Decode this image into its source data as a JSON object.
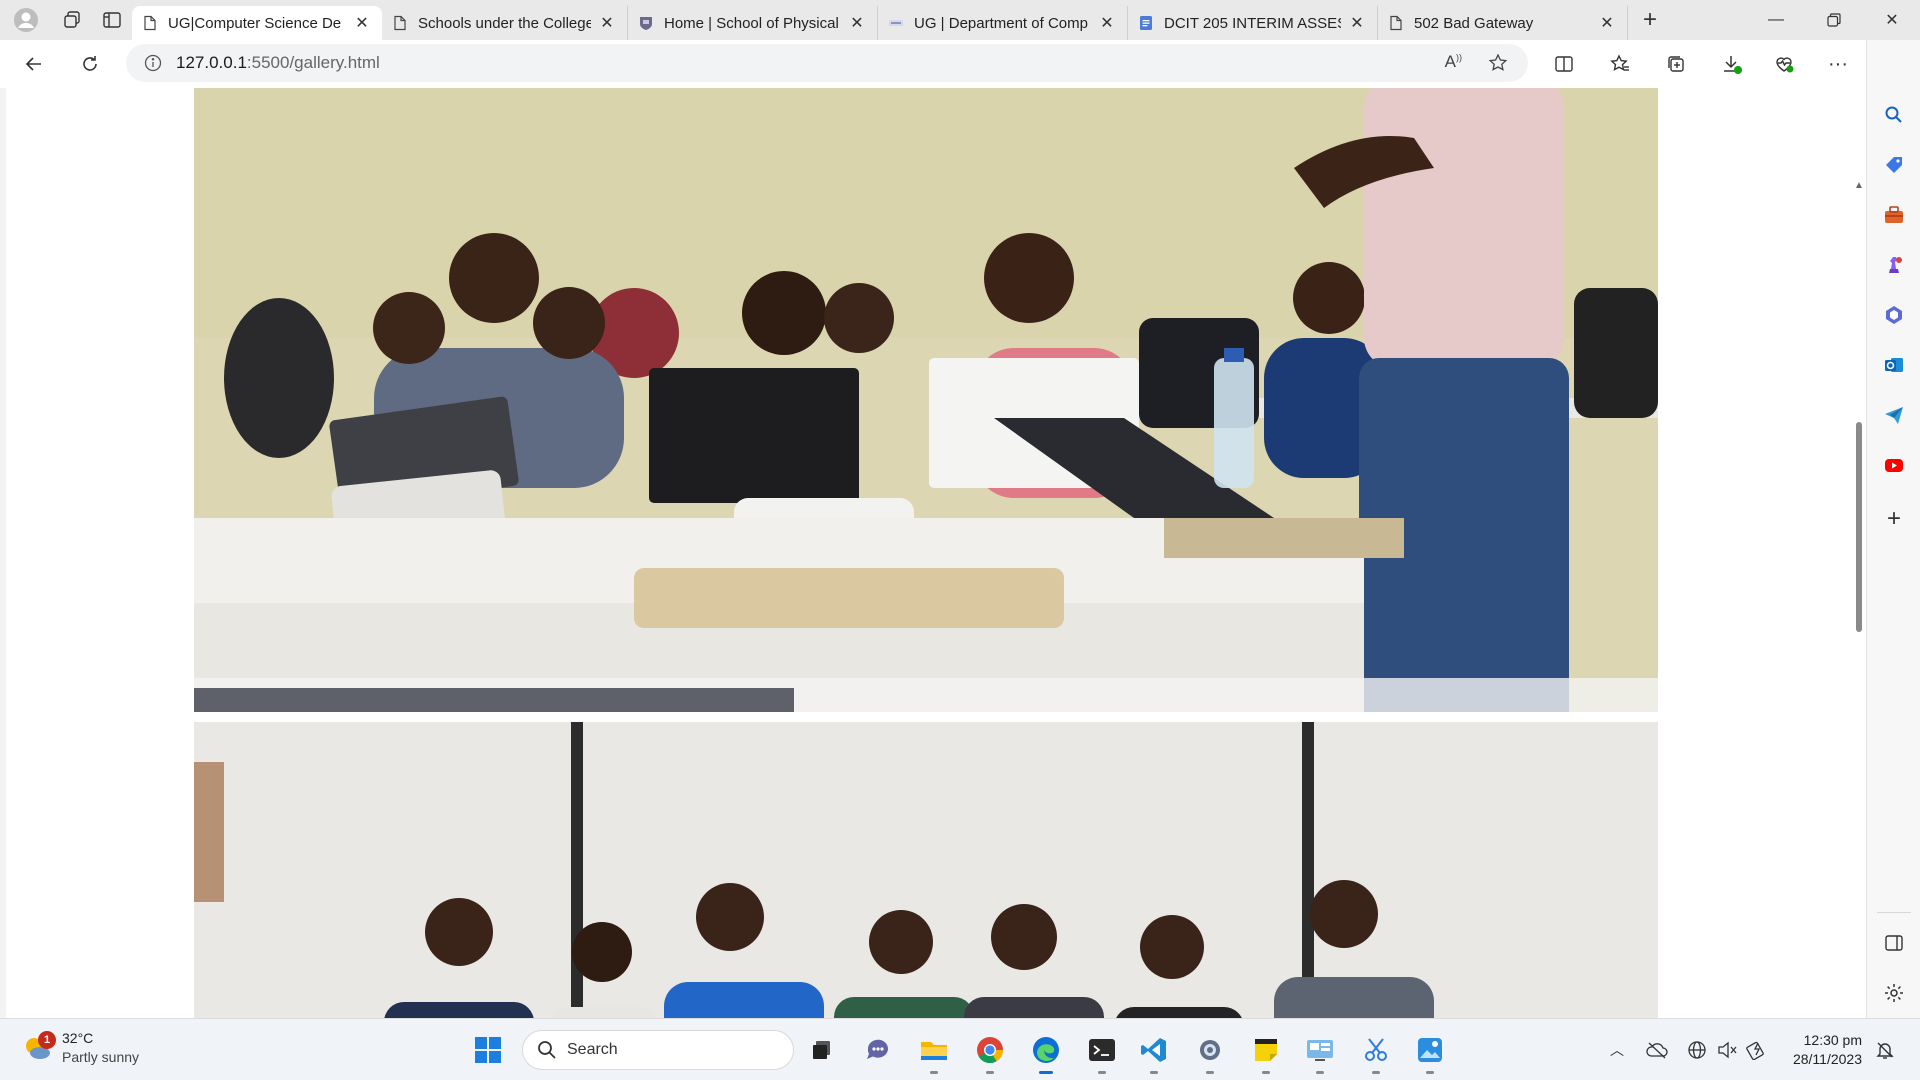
{
  "tabs": [
    {
      "title": "UG|Computer Science De",
      "active": true,
      "icon": "page-icon"
    },
    {
      "title": "Schools under the College",
      "active": false,
      "icon": "page-icon"
    },
    {
      "title": "Home | School of Physical",
      "active": false,
      "icon": "ug-crest-icon"
    },
    {
      "title": "UG | Department of Comp",
      "active": false,
      "icon": "site-favicon-icon"
    },
    {
      "title": "DCIT 205 INTERIM ASSES",
      "active": false,
      "icon": "docs-icon"
    },
    {
      "title": "502 Bad Gateway",
      "active": false,
      "icon": "page-icon"
    }
  ],
  "address": {
    "host": "127.0.0.1",
    "path": ":5500/gallery.html"
  },
  "content": {
    "photos": [
      {
        "description_icon": "classroom-photo"
      },
      {
        "description_icon": "group-photo"
      }
    ]
  },
  "taskbar": {
    "weather": {
      "temp": "32°C",
      "condition": "Partly sunny",
      "badge": "1"
    },
    "search_label": "Search",
    "time": "12:30 pm",
    "date": "28/11/2023"
  },
  "colors": {
    "tabstrip": "#e9e9e9",
    "edge_blue": "#0c6fd6",
    "vscode_blue": "#1f8ad2",
    "youtube_red": "#ff0000",
    "badge_red": "#c42b1c"
  }
}
